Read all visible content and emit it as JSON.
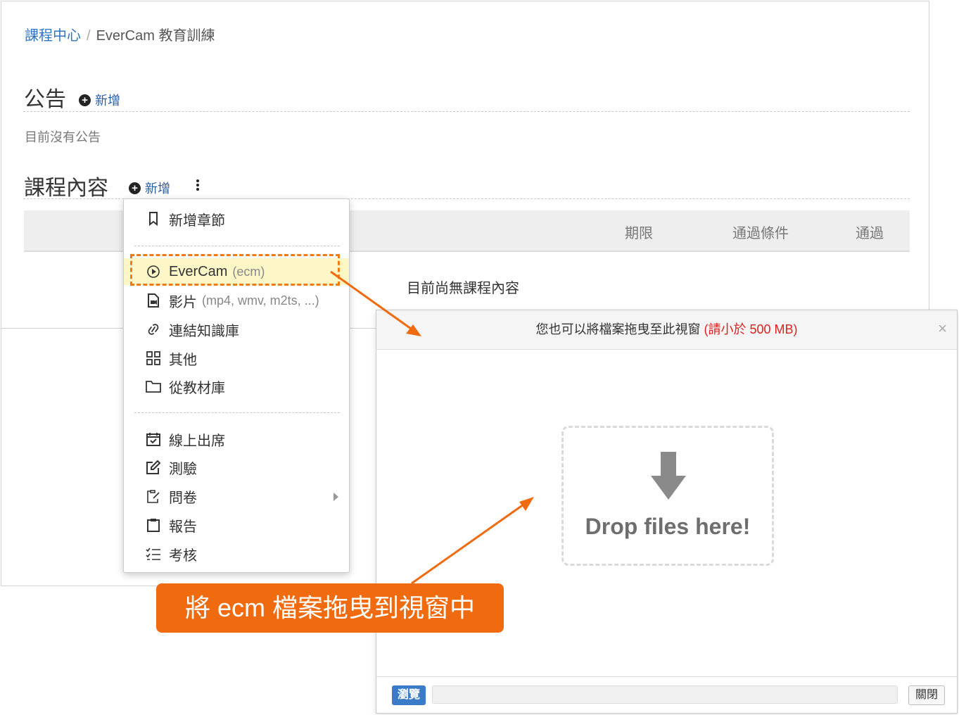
{
  "breadcrumb": {
    "link": "課程中心",
    "separator": "/",
    "current": "EverCam 教育訓練"
  },
  "announcements": {
    "title": "公告",
    "add_label": "新增",
    "empty_text": "目前沒有公告"
  },
  "course_content": {
    "title": "課程內容",
    "add_label": "新增",
    "columns": [
      "期限",
      "通過條件",
      "通過"
    ],
    "empty_text": "目前尚無課程內容"
  },
  "menu": {
    "items": [
      {
        "icon": "bookmark-icon",
        "label": "新增章節",
        "sub": ""
      },
      {
        "icon": "play-circle-icon",
        "label": "EverCam",
        "sub": "(ecm)"
      },
      {
        "icon": "video-file-icon",
        "label": "影片",
        "sub": "(mp4, wmv, m2ts, ...)"
      },
      {
        "icon": "link-icon",
        "label": "連結知識庫",
        "sub": ""
      },
      {
        "icon": "grid-icon",
        "label": "其他",
        "sub": ""
      },
      {
        "icon": "folder-icon",
        "label": "從教材庫",
        "sub": ""
      },
      {
        "icon": "calendar-check-icon",
        "label": "線上出席",
        "sub": ""
      },
      {
        "icon": "edit-icon",
        "label": "測驗",
        "sub": ""
      },
      {
        "icon": "questionnaire-icon",
        "label": "問卷",
        "sub": ""
      },
      {
        "icon": "clipboard-icon",
        "label": "報告",
        "sub": ""
      },
      {
        "icon": "checklist-icon",
        "label": "考核",
        "sub": ""
      }
    ]
  },
  "upload_dialog": {
    "header_text": "您也可以將檔案拖曳至此視窗",
    "size_limit": "(請小於 500 MB)",
    "close_symbol": "×",
    "drop_text": "Drop files here!",
    "browse_label": "瀏覽",
    "close_label": "關閉"
  },
  "annotation": {
    "text": "將 ecm 檔案拖曳到視窗中"
  },
  "colors": {
    "accent": "#f06a0f",
    "link": "#3174c4",
    "highlight": "#fdf7c8",
    "browse": "#3a7bc8",
    "limit": "#e0201c"
  }
}
